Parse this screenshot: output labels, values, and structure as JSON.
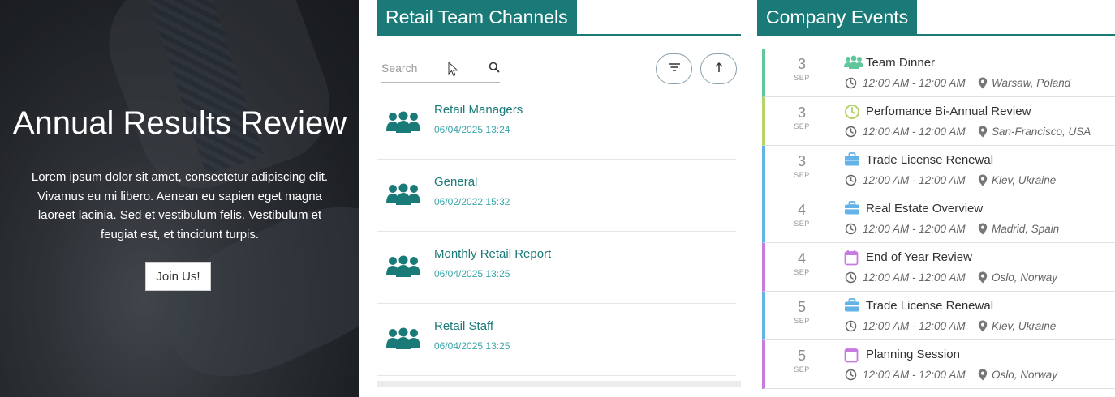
{
  "hero": {
    "title": "Annual Results Review",
    "text": "Lorem ipsum dolor sit amet, consectetur adipiscing elit. Vivamus eu mi libero. Aenean eu sapien eget magna laoreet lacinia. Sed et vestibulum felis. Vestibulum et feugiat est, et tincidunt turpis.",
    "button_label": "Join Us!"
  },
  "channels": {
    "title": "Retail Team Channels",
    "search_placeholder": "Search",
    "items": [
      {
        "name": "Retail Managers",
        "date": "06/04/2025 13:24"
      },
      {
        "name": "General",
        "date": "06/02/2022 15:32"
      },
      {
        "name": "Monthly Retail Report",
        "date": "06/04/2025 13:25"
      },
      {
        "name": "Retail Staff",
        "date": "06/04/2025 13:25"
      }
    ]
  },
  "events": {
    "title": "Company Events",
    "items": [
      {
        "day": "3",
        "month": "SEP",
        "title": "Team Dinner",
        "time": "12:00 AM - 12:00 AM",
        "location": "Warsaw, Poland",
        "icon": "people-icon",
        "color": "#5fc79a"
      },
      {
        "day": "3",
        "month": "SEP",
        "title": "Perfomance Bi-Annual Review",
        "time": "12:00 AM - 12:00 AM",
        "location": "San-Francisco, USA",
        "icon": "clock-icon",
        "color": "#b5d46a"
      },
      {
        "day": "3",
        "month": "SEP",
        "title": "Trade License Renewal",
        "time": "12:00 AM - 12:00 AM",
        "location": "Kiev, Ukraine",
        "icon": "briefcase-icon",
        "color": "#63b3e8"
      },
      {
        "day": "4",
        "month": "SEP",
        "title": "Real Estate Overview",
        "time": "12:00 AM - 12:00 AM",
        "location": "Madrid, Spain",
        "icon": "briefcase-icon",
        "color": "#63b3e8"
      },
      {
        "day": "4",
        "month": "SEP",
        "title": "End of Year Review",
        "time": "12:00 AM - 12:00 AM",
        "location": "Oslo, Norway",
        "icon": "calendar-icon",
        "color": "#c77be0"
      },
      {
        "day": "5",
        "month": "SEP",
        "title": "Trade License Renewal",
        "time": "12:00 AM - 12:00 AM",
        "location": "Kiev, Ukraine",
        "icon": "briefcase-icon",
        "color": "#63b3e8"
      },
      {
        "day": "5",
        "month": "SEP",
        "title": "Planning Session",
        "time": "12:00 AM - 12:00 AM",
        "location": "Oslo, Norway",
        "icon": "calendar-icon",
        "color": "#c77be0"
      }
    ]
  },
  "colors": {
    "accent": "#1a7a78",
    "date": "#3aa5a8"
  }
}
